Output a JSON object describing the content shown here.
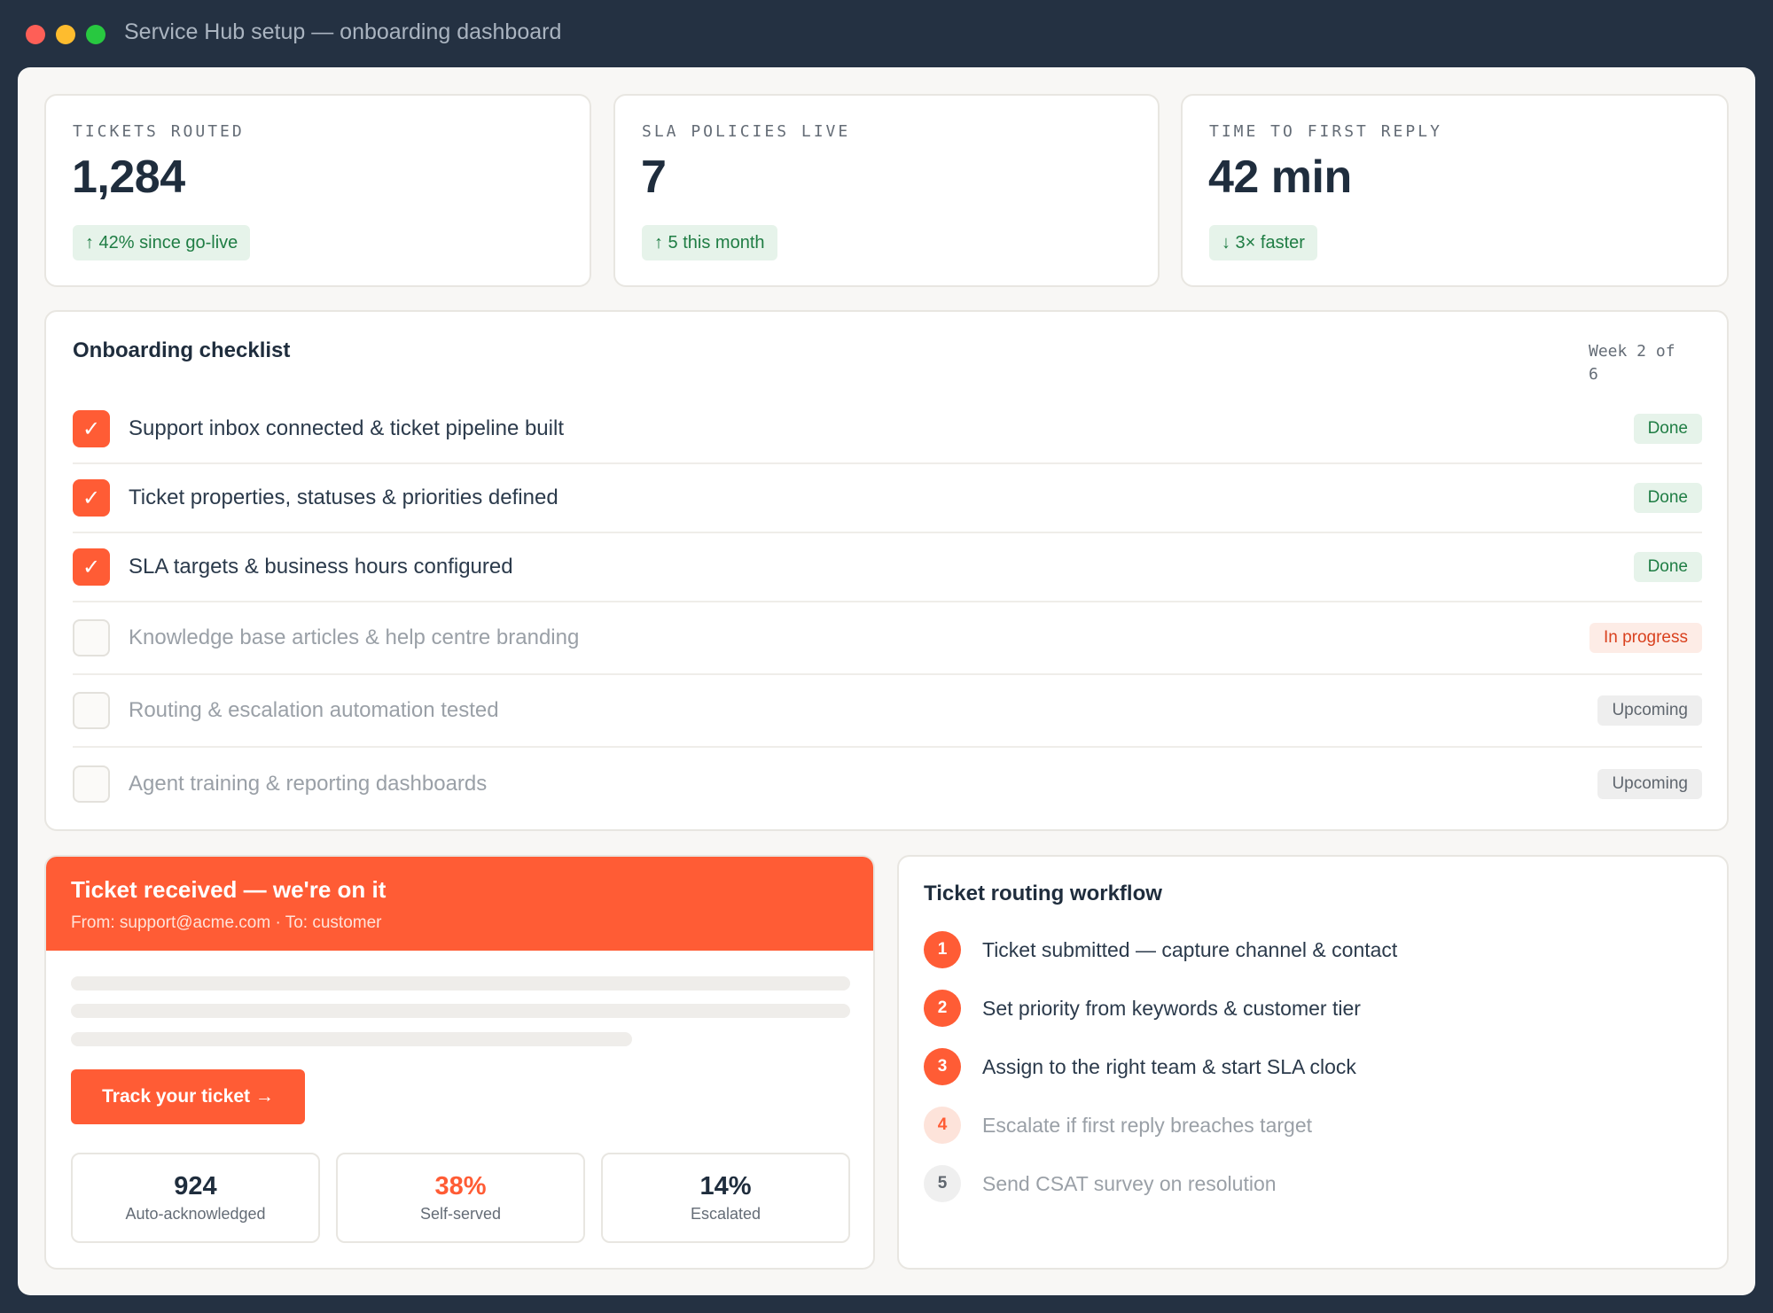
{
  "window": {
    "title": "Service Hub setup — onboarding dashboard"
  },
  "stats": [
    {
      "label": "TICKETS ROUTED",
      "value": "1,284",
      "delta": "↑ 42% since go-live"
    },
    {
      "label": "SLA POLICIES LIVE",
      "value": "7",
      "delta": "↑ 5 this month"
    },
    {
      "label": "TIME TO FIRST REPLY",
      "value": "42 min",
      "delta": "↓ 3× faster"
    }
  ],
  "checklist": {
    "title": "Onboarding checklist",
    "week": "Week 2 of 6",
    "check_glyph": "✓",
    "items": [
      {
        "label": "Support inbox connected & ticket pipeline built",
        "status": "Done",
        "checked": true
      },
      {
        "label": "Ticket properties, statuses & priorities defined",
        "status": "Done",
        "checked": true
      },
      {
        "label": "SLA targets & business hours configured",
        "status": "Done",
        "checked": true
      },
      {
        "label": "Knowledge base articles & help centre branding",
        "status": "In progress",
        "checked": false
      },
      {
        "label": "Routing & escalation automation tested",
        "status": "Upcoming",
        "checked": false
      },
      {
        "label": "Agent training & reporting dashboards",
        "status": "Upcoming",
        "checked": false
      }
    ]
  },
  "email": {
    "title": "Ticket received — we're on it",
    "from_line": "From: support@acme.com · To: customer",
    "cta": "Track your ticket →",
    "metrics": [
      {
        "value": "924",
        "label": "Auto-acknowledged"
      },
      {
        "value": "38%",
        "label": "Self-served"
      },
      {
        "value": "14%",
        "label": "Escalated"
      }
    ]
  },
  "workflow": {
    "title": "Ticket routing workflow",
    "steps": [
      {
        "num": "1",
        "label": "Ticket submitted — capture channel & contact"
      },
      {
        "num": "2",
        "label": "Set priority from keywords & customer tier"
      },
      {
        "num": "3",
        "label": "Assign to the right team & start SLA clock"
      },
      {
        "num": "4",
        "label": "Escalate if first reply breaches target"
      },
      {
        "num": "5",
        "label": "Send CSAT survey on resolution"
      }
    ]
  },
  "colors": {
    "accent": "#ff5c35",
    "frame": "#243142",
    "success": "#1f7d44",
    "success_bg": "#e6f3ea",
    "progress_bg": "#fdece6",
    "neutral_bg": "#eeeeee"
  }
}
